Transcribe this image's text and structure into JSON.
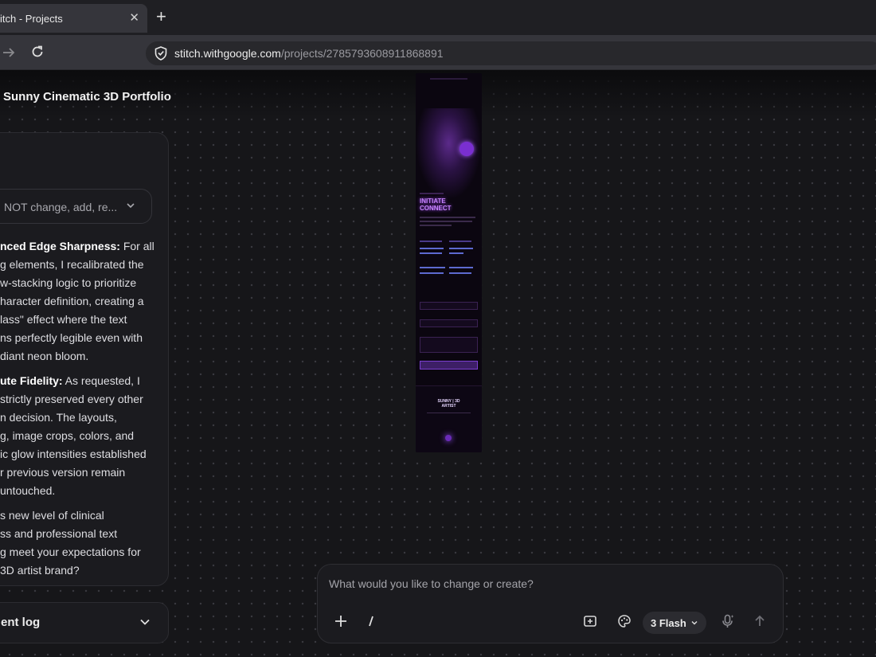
{
  "browser": {
    "tab_title": "itch - Projects",
    "tab_close": "✕",
    "new_tab": "+",
    "url_host": "stitch.withgoogle.com",
    "url_path": "/projects/2785793608911868891"
  },
  "project": {
    "title": "Sunny Cinematic 3D Portfolio"
  },
  "chat": {
    "dropdown_text": "NOT change, add, re...",
    "message_lines": [
      {
        "bold": "nced Edge Sharpness:",
        "text": " For all"
      },
      {
        "bold": "",
        "text": "g elements, I recalibrated the"
      },
      {
        "bold": "",
        "text": "w-stacking logic to prioritize"
      },
      {
        "bold": "",
        "text": "haracter definition, creating a"
      },
      {
        "bold": "",
        "text": "lass\" effect where the text"
      },
      {
        "bold": "",
        "text": "ns perfectly legible even with"
      },
      {
        "bold": "",
        "text": "diant neon bloom."
      },
      {
        "bold": "ute Fidelity:",
        "text": " As requested, I"
      },
      {
        "bold": "",
        "text": "strictly preserved every other"
      },
      {
        "bold": "",
        "text": "n decision. The layouts,"
      },
      {
        "bold": "",
        "text": "g, image crops, colors, and"
      },
      {
        "bold": "",
        "text": "ic glow intensities established"
      },
      {
        "bold": "",
        "text": "r previous version remain"
      },
      {
        "bold": "",
        "text": "untouched."
      },
      {
        "bold": "",
        "text": "s new level of clinical"
      },
      {
        "bold": "",
        "text": "ss and professional text"
      },
      {
        "bold": "",
        "text": "g meet your expectations for"
      },
      {
        "bold": "",
        "text": "3D artist brand?"
      }
    ],
    "log_label": "ent log"
  },
  "preview": {
    "heading_line1": "INITIATE",
    "heading_line2": "CONNECT",
    "footer_line1": "SUNNY | 3D",
    "footer_line2": "ARTIST"
  },
  "composer": {
    "placeholder": "What would you like to change or create?",
    "add_label": "+",
    "slash_label": "/",
    "model_label": "3 Flash"
  }
}
